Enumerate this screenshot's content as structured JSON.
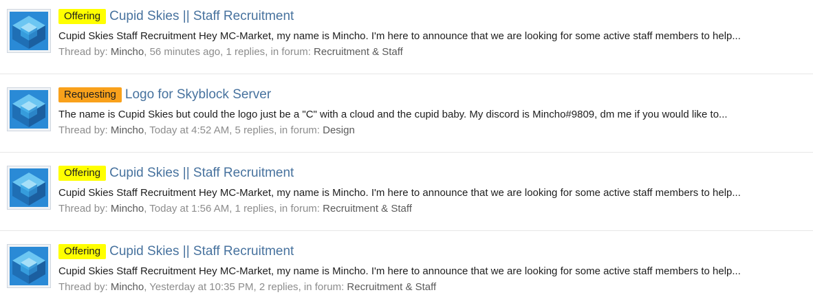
{
  "colors": {
    "title_link": "#47729e",
    "prefix_offering": "#ffff00",
    "prefix_requesting": "#f9a11b",
    "meta_text": "#8c8c8c",
    "meta_link": "#5a5a5a",
    "divider": "#e6e6e6"
  },
  "results": [
    {
      "avatar_icon": "cube-avatar-icon",
      "prefix": "Offering",
      "title": "Cupid Skies || Staff Recruitment",
      "snippet": "Cupid Skies Staff Recruitment Hey MC-Market, my name is Mincho. I'm here to announce that we are looking for some active staff members to help...",
      "meta": {
        "thread_by_label": "Thread by: ",
        "user": "Mincho",
        "time": ", 56 minutes ago",
        "replies": ", 1 replies",
        "in_forum_label": ", in forum: ",
        "forum": "Recruitment & Staff"
      }
    },
    {
      "avatar_icon": "cube-avatar-icon",
      "prefix": "Requesting",
      "title": "Logo for Skyblock Server",
      "snippet": "The name is Cupid Skies but could the logo just be a \"C\" with a cloud and the cupid baby. My discord is Mincho#9809, dm me if you would like to...",
      "meta": {
        "thread_by_label": "Thread by: ",
        "user": "Mincho",
        "time": ", Today at 4:52 AM",
        "replies": ", 5 replies",
        "in_forum_label": ", in forum: ",
        "forum": "Design"
      }
    },
    {
      "avatar_icon": "cube-avatar-icon",
      "prefix": "Offering",
      "title": "Cupid Skies || Staff Recruitment",
      "snippet": "Cupid Skies Staff Recruitment Hey MC-Market, my name is Mincho. I'm here to announce that we are looking for some active staff members to help...",
      "meta": {
        "thread_by_label": "Thread by: ",
        "user": "Mincho",
        "time": ", Today at 1:56 AM",
        "replies": ", 1 replies",
        "in_forum_label": ", in forum: ",
        "forum": "Recruitment & Staff"
      }
    },
    {
      "avatar_icon": "cube-avatar-icon",
      "prefix": "Offering",
      "title": "Cupid Skies || Staff Recruitment",
      "snippet": "Cupid Skies Staff Recruitment Hey MC-Market, my name is Mincho. I'm here to announce that we are looking for some active staff members to help...",
      "meta": {
        "thread_by_label": "Thread by: ",
        "user": "Mincho",
        "time": ", Yesterday at 10:35 PM",
        "replies": ", 2 replies",
        "in_forum_label": ", in forum: ",
        "forum": "Recruitment & Staff"
      }
    }
  ]
}
